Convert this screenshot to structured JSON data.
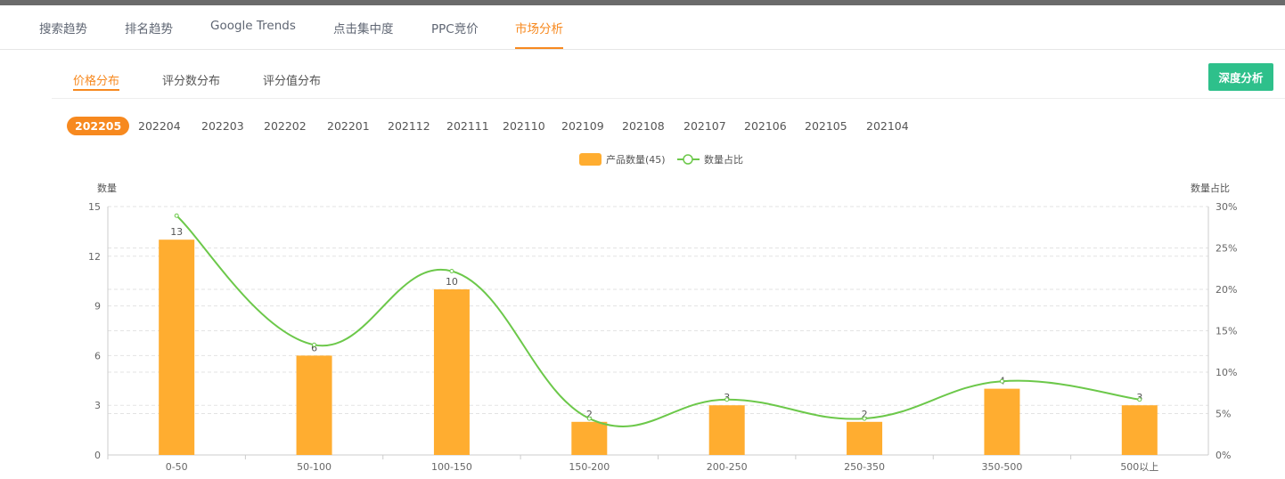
{
  "tabs": [
    "搜索趋势",
    "排名趋势",
    "Google Trends",
    "点击集中度",
    "PPC竞价",
    "市场分析"
  ],
  "active_tab": 5,
  "subtabs": [
    "价格分布",
    "评分数分布",
    "评分值分布"
  ],
  "deep_button": "深度分析",
  "months": [
    "202205",
    "202204",
    "202203",
    "202202",
    "202201",
    "202112",
    "202111",
    "202110",
    "202109",
    "202108",
    "202107",
    "202106",
    "202105",
    "202104"
  ],
  "colors": {
    "accent": "#f7891f",
    "bar": "#ffad30",
    "line": "#6cc84a",
    "button": "#2ec08b"
  },
  "chart_data": {
    "type": "bar",
    "categories": [
      "0-50",
      "50-100",
      "100-150",
      "150-200",
      "200-250",
      "250-350",
      "350-500",
      "500以上"
    ],
    "series": [
      {
        "name": "产品数量(45)",
        "type": "bar",
        "axis": "left",
        "values": [
          13,
          6,
          10,
          2,
          3,
          2,
          4,
          3
        ]
      },
      {
        "name": "数量占比",
        "type": "line",
        "axis": "right",
        "values": [
          28.9,
          13.3,
          22.2,
          4.4,
          6.7,
          4.4,
          8.9,
          6.7
        ]
      }
    ],
    "ylabel": "数量",
    "ylabel_right": "数量占比",
    "ylim": [
      0,
      15
    ],
    "yticks": [
      0,
      3,
      6,
      9,
      12,
      15
    ],
    "ylim_right": [
      0,
      30
    ],
    "yticks_right": [
      "0%",
      "5%",
      "10%",
      "15%",
      "20%",
      "25%",
      "30%"
    ],
    "legend": "top-center",
    "grid": true
  }
}
